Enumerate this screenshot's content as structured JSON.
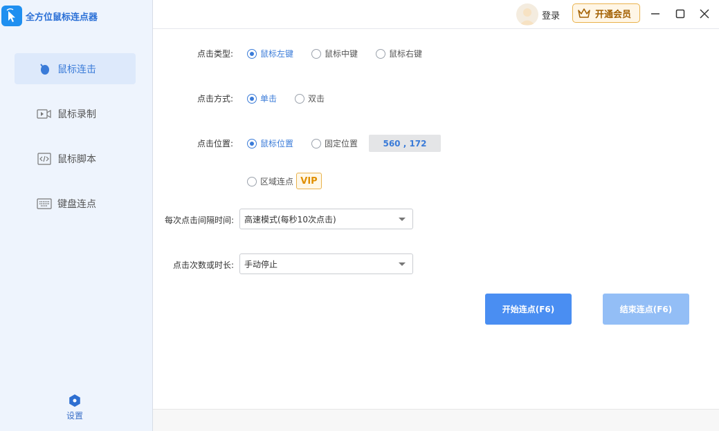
{
  "app": {
    "title": "全方位鼠标连点器"
  },
  "sidebar": {
    "items": [
      {
        "label": "鼠标连击",
        "icon": "mouse-icon",
        "active": true
      },
      {
        "label": "鼠标录制",
        "icon": "video-record-icon",
        "active": false
      },
      {
        "label": "鼠标脚本",
        "icon": "code-icon",
        "active": false
      },
      {
        "label": "键盘连点",
        "icon": "keyboard-icon",
        "active": false
      }
    ],
    "settings_label": "设置"
  },
  "titlebar": {
    "login_label": "登录",
    "vip_label": "开通会员"
  },
  "form": {
    "click_type": {
      "label": "点击类型:",
      "options": [
        "鼠标左键",
        "鼠标中键",
        "鼠标右键"
      ],
      "selected": "鼠标左键"
    },
    "click_mode": {
      "label": "点击方式:",
      "options": [
        "单击",
        "双击"
      ],
      "selected": "单击"
    },
    "click_position": {
      "label": "点击位置:",
      "options": [
        "鼠标位置",
        "固定位置",
        "区域连点"
      ],
      "selected": "鼠标位置",
      "coord_value": "560 , 172",
      "vip_badge": "VIP"
    },
    "interval": {
      "label": "每次点击间隔时间:",
      "value": "高速模式(每秒10次点击)"
    },
    "count": {
      "label": "点击次数或时长:",
      "value": "手动停止"
    }
  },
  "buttons": {
    "start_label": "开始连点(F6)",
    "stop_label": "结束连点(F6)"
  },
  "colors": {
    "accent": "#3a7bd8",
    "start_button": "#4a8ef2",
    "stop_button": "#93bef6",
    "vip": "#e9b24b"
  }
}
